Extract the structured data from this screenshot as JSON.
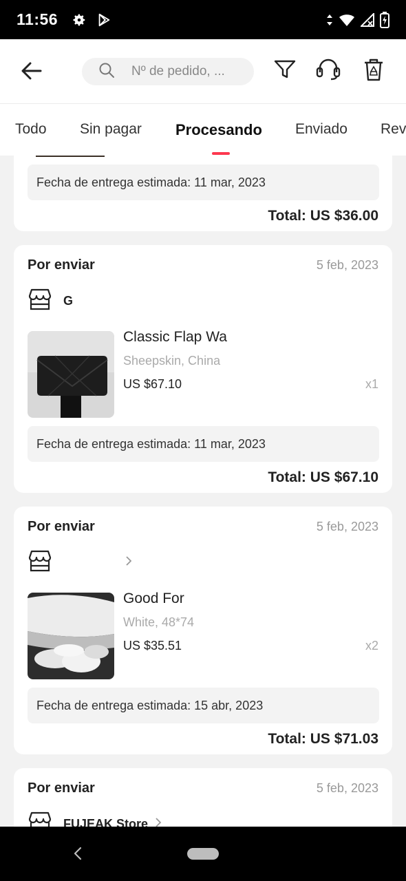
{
  "status_bar": {
    "time": "11:56",
    "icons_left": [
      "gear-icon",
      "play-store-icon"
    ],
    "icons_right": [
      "data-arrows-icon",
      "wifi-icon",
      "signal-icon",
      "battery-charging-icon"
    ]
  },
  "header": {
    "back_icon": "arrow-left-icon",
    "search_placeholder": "Nº de pedido, ...",
    "icons": [
      "filter-icon",
      "headset-icon",
      "trash-icon"
    ]
  },
  "tabs": {
    "items": [
      {
        "label": "Todo"
      },
      {
        "label": "Sin pagar"
      },
      {
        "label": "Procesando",
        "active": true
      },
      {
        "label": "Enviado"
      },
      {
        "label": "Rev"
      }
    ],
    "accent": "#fd384f"
  },
  "orders": [
    {
      "delivery": "Fecha de entrega estimada: 11 mar, 2023",
      "total": "Total: US $36.00"
    },
    {
      "status": "Por enviar",
      "date": "5 feb, 2023",
      "store": "G",
      "product": {
        "title": "Classic Flap Wa",
        "variant": "Sheepskin, China",
        "price": "US $67.10",
        "qty": "x1"
      },
      "delivery": "Fecha de entrega estimada: 11 mar, 2023",
      "total": "Total: US $67.10"
    },
    {
      "status": "Por enviar",
      "date": "5 feb, 2023",
      "store": "",
      "product": {
        "title": "Good For",
        "variant": "White, 48*74",
        "price": "US $35.51",
        "qty": "x2"
      },
      "delivery": "Fecha de entrega estimada: 15 abr, 2023",
      "total": "Total: US $71.03"
    },
    {
      "status": "Por enviar",
      "date": "5 feb, 2023",
      "store": "FUJEAK Store"
    }
  ],
  "nav_bar": {
    "icons": [
      "nav-back-icon",
      "home-pill-icon"
    ]
  }
}
